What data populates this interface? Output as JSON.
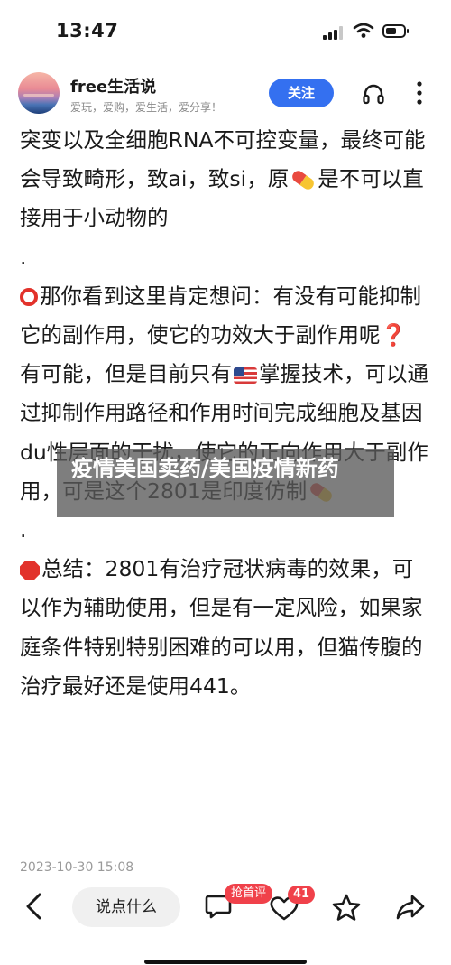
{
  "status_bar": {
    "time": "13:47"
  },
  "header": {
    "author_name": "free生活说",
    "author_bio": "爱玩，爱购，爱生活，爱分享！",
    "follow_label": "关注"
  },
  "article": {
    "p1a": "突变以及全细胞RNA不可控变量，最终可能会导致畸形，致ai，致si，原",
    "p1b": "是不可以直接用于小动物的",
    "p2": ".",
    "p3": "那你看到这里肯定想问：有没有可能抑制它的副作用，使它的功效大于副作用呢",
    "p3_mark": "❓",
    "p4a": "有可能，但是目前只有",
    "p4b": "掌握技术，可以通过抑制作用路径和作用时间完成细胞及基因du性层面的干扰，使它的正向作用大于副作用，可是这个2801是印度仿制",
    "p5": ".",
    "p6": "总结：2801有治疗冠状病毒的效果，可以作为辅助使用，但是有一定风险，如果家庭条件特别特别困难的可以用，但猫传腹的治疗最好还是使用441。",
    "timestamp": "2023-10-30 15:08"
  },
  "watermark": {
    "text": "疫情美国卖药/美国疫情新药"
  },
  "bottom_bar": {
    "comment_placeholder": "说点什么",
    "grab_badge": "抢首评",
    "like_count": "41"
  },
  "icons": {
    "pill": "pill-icon",
    "ring": "red-circle-icon",
    "flag": "us-flag-icon",
    "stop": "stop-sign-icon"
  },
  "colors": {
    "accent": "#3470f0",
    "badge": "#f0414a",
    "alert_red": "#e2322b"
  }
}
